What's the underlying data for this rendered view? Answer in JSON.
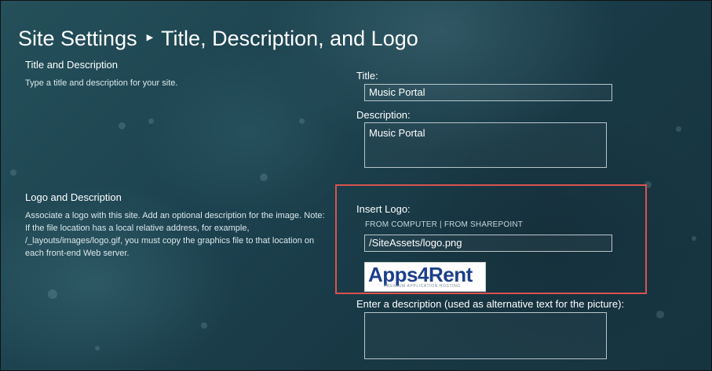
{
  "header": {
    "root": "Site Settings",
    "separator_icon": "triangle-right-icon",
    "page": "Title, Description, and Logo"
  },
  "title_section": {
    "heading": "Title and Description",
    "description": "Type a title and description for your site.",
    "title_label": "Title:",
    "title_value": "Music Portal",
    "description_label": "Description:",
    "description_value": "Music Portal"
  },
  "logo_section": {
    "heading": "Logo and Description",
    "description": "Associate a logo with this site. Add an optional description for the image. Note: If the file location has a local relative address, for example, /_layouts/images/logo.gif, you must copy the graphics file to that location on each front-end Web server.",
    "insert_label": "Insert Logo:",
    "from_computer": "FROM COMPUTER",
    "link_separator": "|",
    "from_sharepoint": "FROM SHAREPOINT",
    "logo_url": "/SiteAssets/logo.png",
    "logo_brand": "Apps4Rent",
    "logo_tagline": "PREMIUM APPLICATION HOSTING",
    "alt_label": "Enter a description (used as alternative text for the picture):",
    "alt_value": ""
  },
  "colors": {
    "highlight": "#d9534f",
    "logo_brand": "#1c3f8a",
    "text": "#ffffff"
  }
}
